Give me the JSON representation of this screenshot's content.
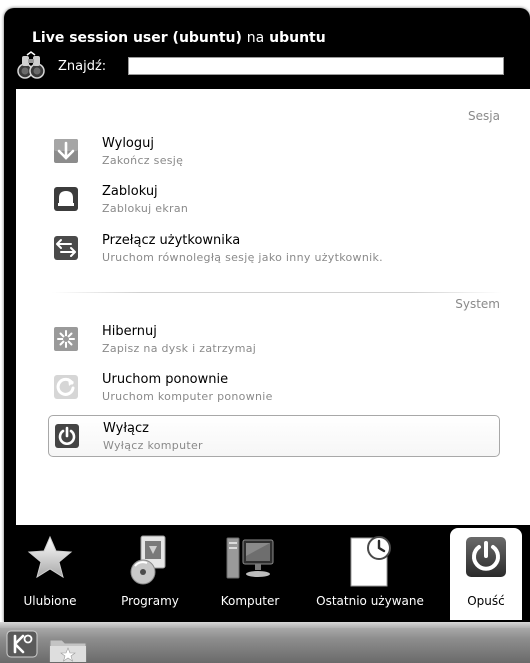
{
  "header": {
    "title_user": "Live session user (ubuntu)",
    "title_sep": "na",
    "title_host": "ubuntu"
  },
  "search": {
    "label": "Znajdź:",
    "value": "",
    "placeholder": ""
  },
  "sections": {
    "session": "Sesja",
    "system": "System"
  },
  "items": [
    {
      "title": "Wyloguj",
      "subtitle": "Zakończ sesję",
      "icon": "logout-arrow-down-icon"
    },
    {
      "title": "Zablokuj",
      "subtitle": "Zablokuj ekran",
      "icon": "lock-icon"
    },
    {
      "title": "Przełącz użytkownika",
      "subtitle": "Uruchom równoległą sesję jako inny użytkownik.",
      "icon": "switch-user-icon"
    },
    {
      "title": "Hibernuj",
      "subtitle": "Zapisz na dysk i zatrzymaj",
      "icon": "hibernate-icon"
    },
    {
      "title": "Uruchom ponownie",
      "subtitle": "Uruchom komputer ponownie",
      "icon": "restart-icon"
    },
    {
      "title": "Wyłącz",
      "subtitle": "Wyłącz komputer",
      "icon": "shutdown-icon"
    }
  ],
  "tabs": [
    {
      "label": "Ulubione",
      "icon": "star-icon"
    },
    {
      "label": "Programy",
      "icon": "applications-icon"
    },
    {
      "label": "Komputer",
      "icon": "computer-icon"
    },
    {
      "label": "Ostatnio używane",
      "icon": "recent-documents-icon"
    },
    {
      "label": "Opuść",
      "icon": "leave-power-icon"
    }
  ],
  "colors": {
    "menu_background": "#000000",
    "accent_dark": "#4a4a4a",
    "muted_text": "#8a8a8a"
  }
}
